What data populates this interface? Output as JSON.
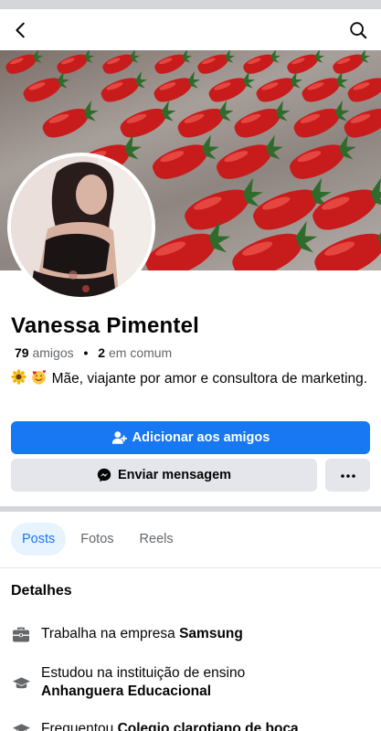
{
  "header": {
    "back_icon": "chevron-left-icon",
    "search_icon": "search-icon"
  },
  "profile": {
    "name": "Vanessa Pimentel",
    "friends_count": "79",
    "friends_label": "amigos",
    "mutual_count": "2",
    "mutual_label": "em comum",
    "bio_emojis": [
      "sunflower-icon",
      "smiling-face-with-hearts-icon"
    ],
    "bio_text": "Mãe, viajante por amor e consultora de marketing."
  },
  "actions": {
    "add_friend_label": "Adicionar aos amigos",
    "message_label": "Enviar mensagem",
    "more_icon": "more-dots-icon"
  },
  "tabs": [
    {
      "label": "Posts",
      "active": true
    },
    {
      "label": "Fotos",
      "active": false
    },
    {
      "label": "Reels",
      "active": false
    }
  ],
  "details": {
    "title": "Detalhes",
    "items": [
      {
        "icon": "briefcase-icon",
        "prefix": "Trabalha na empresa ",
        "bold": "Samsung"
      },
      {
        "icon": "graduation-cap-icon",
        "prefix": "Estudou na instituição de ensino",
        "bold": "Anhanguera Educacional"
      },
      {
        "icon": "graduation-cap-icon",
        "prefix": "Frequentou ",
        "bold": "Colegio clarotiano de boca"
      }
    ]
  },
  "colors": {
    "accent": "#1877f2",
    "secondary_button": "#e4e6eb",
    "muted_text": "#65676b",
    "active_tab_bg": "#e7f3ff"
  }
}
